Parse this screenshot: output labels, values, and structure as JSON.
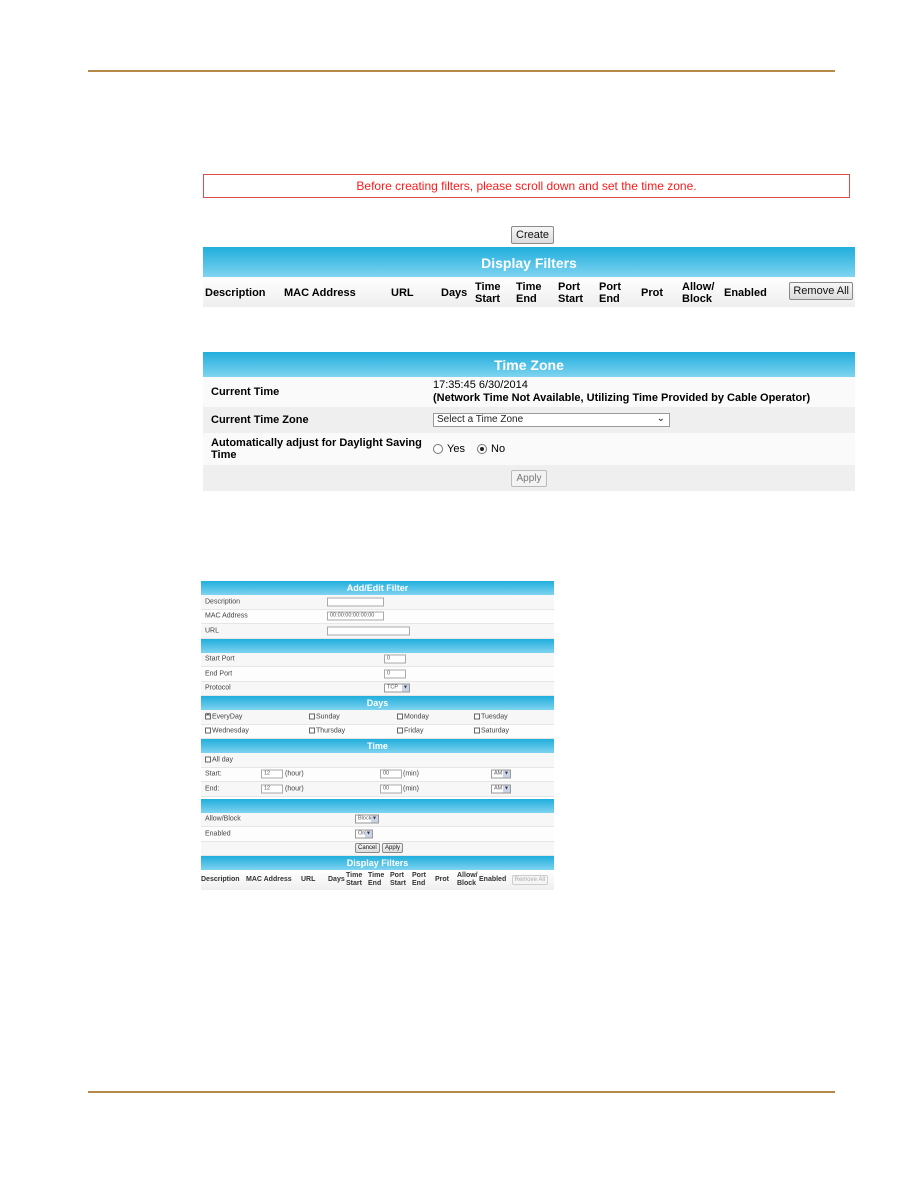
{
  "notice": "Before creating filters, please scroll down and set the time zone.",
  "create_label": "Create",
  "display_filters": {
    "title": "Display Filters",
    "columns": [
      "Description",
      "MAC Address",
      "URL",
      "Days",
      "Time Start",
      "Time End",
      "Port Start",
      "Port End",
      "Prot",
      "Allow/ Block",
      "Enabled"
    ],
    "col_lines": [
      [
        "Description"
      ],
      [
        "MAC Address"
      ],
      [
        "URL"
      ],
      [
        "Days"
      ],
      [
        "Time",
        "Start"
      ],
      [
        "Time",
        "End"
      ],
      [
        "Port",
        "Start"
      ],
      [
        "Port",
        "End"
      ],
      [
        "Prot"
      ],
      [
        "Allow/",
        "Block"
      ],
      [
        "Enabled"
      ]
    ],
    "remove_all_label": "Remove All"
  },
  "time_zone": {
    "title": "Time Zone",
    "current_time_label": "Current Time",
    "current_time_value": "17:35:45 6/30/2014",
    "current_time_note": "(Network Time Not Available, Utilizing Time Provided by Cable Operator)",
    "current_zone_label": "Current Time Zone",
    "current_zone_value": "Select a Time Zone",
    "dst_label": "Automatically adjust for Daylight Saving Time",
    "dst_options": [
      "Yes",
      "No"
    ],
    "dst_selected": "No",
    "apply_label": "Apply"
  },
  "add_edit": {
    "title": "Add/Edit Filter",
    "description_label": "Description",
    "description_value": "",
    "mac_label": "MAC Address",
    "mac_value": "00:00:00:00:00:00",
    "url_label": "URL",
    "url_value": "",
    "start_port_label": "Start Port",
    "start_port_value": "0",
    "end_port_label": "End Port",
    "end_port_value": "0",
    "protocol_label": "Protocol",
    "protocol_value": "TCP",
    "days_title": "Days",
    "days": [
      {
        "label": "EveryDay",
        "checked": true
      },
      {
        "label": "Sunday",
        "checked": false
      },
      {
        "label": "Monday",
        "checked": false
      },
      {
        "label": "Tuesday",
        "checked": false
      },
      {
        "label": "Wednesday",
        "checked": false
      },
      {
        "label": "Thursday",
        "checked": false
      },
      {
        "label": "Friday",
        "checked": false
      },
      {
        "label": "Saturday",
        "checked": false
      }
    ],
    "time_title": "Time",
    "all_day_label": "All day",
    "start_label": "Start:",
    "end_label": "End:",
    "hour_unit": "(hour)",
    "min_unit": "(min)",
    "start_hour": "12",
    "start_min": "00",
    "start_ampm": "AM",
    "end_hour": "12",
    "end_min": "00",
    "end_ampm": "AM",
    "allow_block_label": "Allow/Block",
    "allow_block_value": "Block",
    "enabled_label": "Enabled",
    "enabled_value": "On",
    "cancel_label": "Cancel",
    "apply_label": "Apply",
    "display_filters_title": "Display Filters",
    "remove_all_label": "Remove All"
  }
}
